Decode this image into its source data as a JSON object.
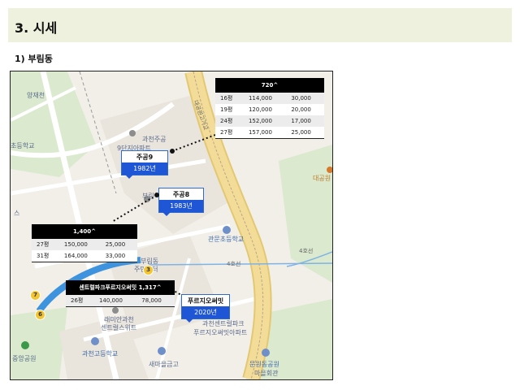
{
  "section": {
    "title": "3. 시세"
  },
  "subsection": {
    "title": "1) 부림동"
  },
  "map": {
    "poi": {
      "yangjaecheon": "양재천",
      "elementary_left": "초등학교",
      "gwacheon_jugong9": "과천주공",
      "gwacheon_jugong9_line2": "9단지아파트",
      "daegongwon": "대공원",
      "gwanmun_school": "관문초등학교",
      "burim_center": "부림동",
      "burim_center_line2": "주민센터",
      "remian_1": "래미안과천",
      "remian_2": "센트럴스위트",
      "central_park_1": "과천센트럴파크",
      "central_park_2": "푸르지오써밋아파트",
      "high_school": "과천고등학교",
      "saemaeul": "새마을금고",
      "jungang_park": "중앙공원",
      "munwon_1": "문원동공원",
      "munwon_2": "마을회관",
      "burim_small": "부림",
      "su": "스"
    },
    "roads": {
      "road_vertical": "대공원고가교",
      "line4_a": "4호선",
      "line4_b": "4호선"
    },
    "badges": {
      "b3": "3",
      "b6": "6",
      "b7": "7"
    }
  },
  "tables": {
    "t720": {
      "header": "720^",
      "rows": [
        [
          "16평",
          "114,000",
          "30,000"
        ],
        [
          "19평",
          "120,000",
          "20,000"
        ],
        [
          "24평",
          "152,000",
          "17,000"
        ],
        [
          "27평",
          "157,000",
          "25,000"
        ]
      ]
    },
    "t1400": {
      "header": "1,400^",
      "rows": [
        [
          "27평",
          "150,000",
          "25,000"
        ],
        [
          "31평",
          "164,000",
          "33,000"
        ]
      ]
    },
    "tcp": {
      "header": "센트럴파크푸르지오써밋 1,317^",
      "rows": [
        [
          "26평",
          "140,000",
          "78,000"
        ]
      ]
    }
  },
  "tags": {
    "jugong9": {
      "name": "주공9",
      "year": "1982년"
    },
    "jugong8": {
      "name": "주공8",
      "year": "1983년"
    },
    "prugio": {
      "name": "푸르지오써밋",
      "year": "2020년"
    }
  },
  "colors": {
    "header_band": "#eef1dd",
    "tag_year_bg": "#1f56d6",
    "table_header_bg": "#000000",
    "rail_line4": "#7fb3e6",
    "highway": "#f3dc98"
  }
}
